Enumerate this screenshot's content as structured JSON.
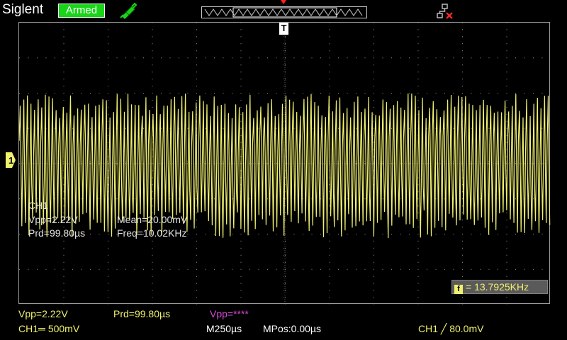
{
  "header": {
    "brand": "Siglent",
    "status": "Armed",
    "icons": [
      "probe-icon",
      "network-disconnected-icon"
    ]
  },
  "screen": {
    "trigger_marker": "T",
    "channel_marker": "1",
    "trace_color": "#f0f070",
    "grid_color": "#9a9a9a"
  },
  "overlay": {
    "channel": "CH1",
    "vpp": "Vpp=2.22V",
    "mean": "Mean=20.00mV",
    "prd": "Prd=99.80µs",
    "freq": "Freq=10.02KHz"
  },
  "trigger_freq": {
    "icon": "f",
    "value": "= 13.7925KHz"
  },
  "bottom": {
    "vpp_ch1": "Vpp=2.22V",
    "prd_ch1": "Prd=99.80µs",
    "vpp_ch2": "Vpp=****",
    "ch1_scale": "CH1═ 500mV",
    "timebase": "M250µs",
    "mpos": "MPos:0.00µs",
    "trigger": "CH1 ╱ 80.0mV"
  }
}
